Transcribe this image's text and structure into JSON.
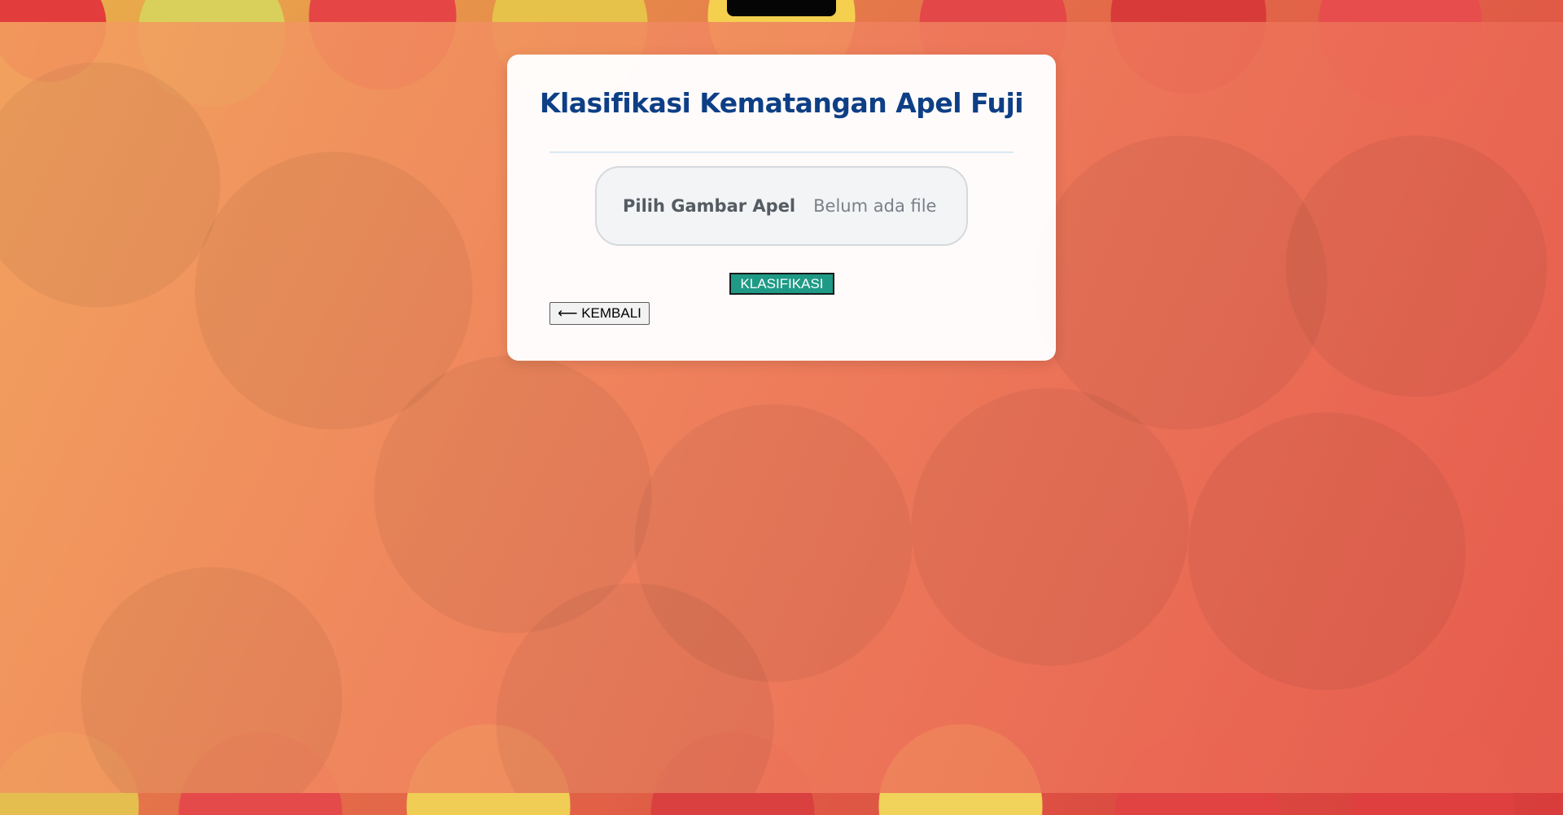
{
  "app": {
    "title": "Klasifikasi Kematangan Apel Fuji"
  },
  "upload": {
    "label": "Pilih Gambar Apel",
    "status": "Belum ada file"
  },
  "actions": {
    "classify_label": "KLASIFIKASI",
    "back_label": "⟵ KEMBALI"
  },
  "colors": {
    "title": "#0e3f86",
    "classify_button": "#1e9a86",
    "overlay": "#f08a5f"
  }
}
